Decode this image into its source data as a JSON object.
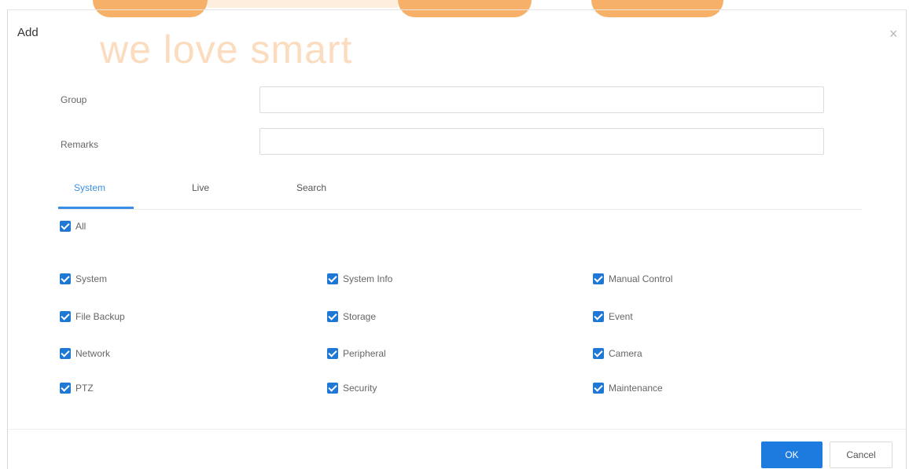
{
  "watermark": {
    "text": "we love smart"
  },
  "dialog": {
    "title": "Add",
    "close_glyph": "×"
  },
  "form": {
    "group_label": "Group",
    "group_value": "",
    "remarks_label": "Remarks",
    "remarks_value": ""
  },
  "tabs": [
    {
      "label": "System",
      "active": true
    },
    {
      "label": "Live",
      "active": false
    },
    {
      "label": "Search",
      "active": false
    }
  ],
  "permissions": {
    "all_label": "All",
    "all_checked": true,
    "items": [
      {
        "label": "System",
        "checked": true
      },
      {
        "label": "System Info",
        "checked": true
      },
      {
        "label": "Manual Control",
        "checked": true
      },
      {
        "label": "File Backup",
        "checked": true
      },
      {
        "label": "Storage",
        "checked": true
      },
      {
        "label": "Event",
        "checked": true
      },
      {
        "label": "Network",
        "checked": true
      },
      {
        "label": "Peripheral",
        "checked": true
      },
      {
        "label": "Camera",
        "checked": true
      },
      {
        "label": "PTZ",
        "checked": true
      },
      {
        "label": "Security",
        "checked": true
      },
      {
        "label": "Maintenance",
        "checked": true
      }
    ]
  },
  "buttons": {
    "ok": "OK",
    "cancel": "Cancel"
  },
  "colors": {
    "primary": "#1d7be0",
    "checkbox": "#1f78d4",
    "tab_active": "#3d8fe0",
    "watermark": "#f6b067"
  }
}
